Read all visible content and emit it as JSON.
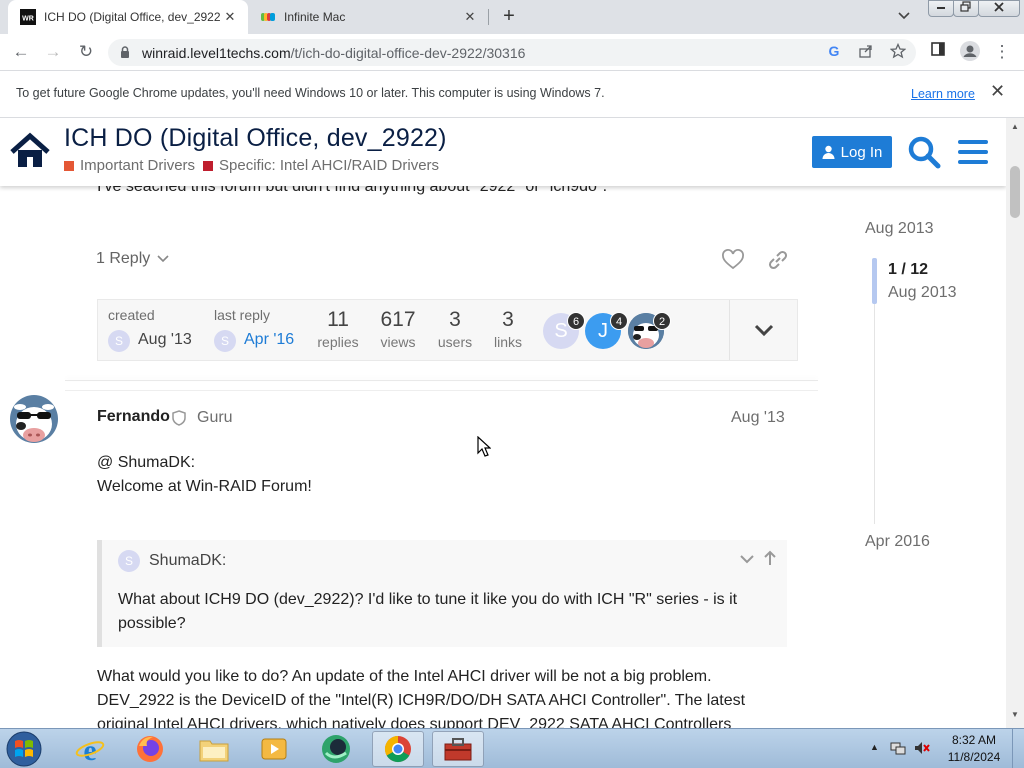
{
  "browser": {
    "tabs": [
      {
        "title": "ICH DO (Digital Office, dev_2922",
        "favicon_text": "WR",
        "active": true
      },
      {
        "title": "Infinite Mac",
        "favicon_text": "",
        "active": false
      }
    ],
    "new_tab_symbol": "+",
    "close_symbol": "✕",
    "url_host": "winraid.level1techs.com",
    "url_path": "/t/ich-do-digital-office-dev-2922/30316",
    "back_symbol": "←",
    "forward_symbol": "→",
    "reload_symbol": "↻",
    "menu_symbol": "⋮"
  },
  "infobar": {
    "message": "To get future Google Chrome updates, you'll need Windows 10 or later. This computer is using Windows 7.",
    "learn_more": "Learn more",
    "close_symbol": "✕"
  },
  "header": {
    "title": "ICH DO (Digital Office, dev_2922)",
    "categories": [
      {
        "label": "Important Drivers",
        "color": "#e45735"
      },
      {
        "label": "Specific: Intel AHCI/RAID Drivers",
        "color": "#bf1e2e"
      }
    ],
    "login_label": "Log In"
  },
  "post1": {
    "text_tail": "I've seached this forum but didn't find anything about \"2922\" or \"ich9do\".",
    "replies_toggle": "1 Reply"
  },
  "topic_map": {
    "created_label": "created",
    "created_date": "Aug '13",
    "created_avatar": "S",
    "last_reply_label": "last reply",
    "last_reply_date": "Apr '16",
    "last_reply_avatar": "S",
    "stats": [
      {
        "value": "11",
        "label": "replies"
      },
      {
        "value": "617",
        "label": "views"
      },
      {
        "value": "3",
        "label": "users"
      },
      {
        "value": "3",
        "label": "links"
      }
    ],
    "participants": [
      {
        "letter": "S",
        "count": "6",
        "color": "#d6d9f2"
      },
      {
        "letter": "J",
        "count": "4",
        "color": "#3c9cf0"
      },
      {
        "letter": "",
        "count": "2",
        "color": "#4a6b8a"
      }
    ]
  },
  "post2": {
    "username": "Fernando",
    "user_title": "Guru",
    "date": "Aug '13",
    "greeting": "@ ShumaDK:",
    "welcome": "Welcome at Win-RAID Forum!",
    "quote_author": "ShumaDK:",
    "quote_avatar": "S",
    "quote_text": "What about ICH9 DO (dev_2922)? I'd like to tune it like you do with ICH \"R\" series - is it possible?",
    "body_line1": "What would you like to do? An update of the Intel AHCI driver will be not a big problem.",
    "body_line2": "DEV_2922 is the DeviceID of the \"Intel(R) ICH9R/DO/DH SATA AHCI Controller\". The latest",
    "body_line3": "original Intel AHCI drivers, which natively does support DEV_2922 SATA AHCI Controllers"
  },
  "timeline": {
    "top_date": "Aug 2013",
    "position": "1 / 12",
    "position_date": "Aug 2013",
    "bottom_date": "Apr 2016"
  },
  "taskbar": {
    "apps": [
      "internet-explorer",
      "firefox",
      "file-explorer",
      "media-player",
      "app-green",
      "chrome",
      "toolbox"
    ],
    "time": "8:32 AM",
    "date": "11/8/2024"
  }
}
